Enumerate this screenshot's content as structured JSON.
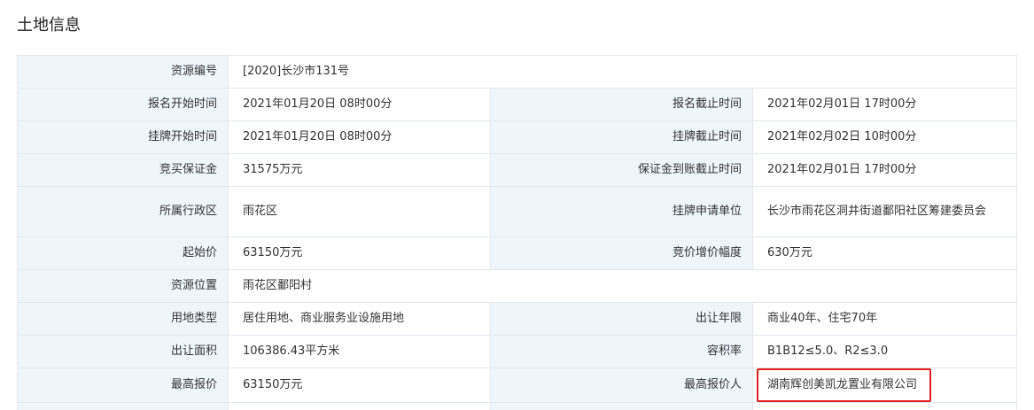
{
  "page": {
    "title": "土地信息"
  },
  "rows": [
    {
      "l1": "资源编号",
      "v1": "[2020]长沙市131号"
    },
    {
      "l1": "报名开始时间",
      "v1": "2021年01月20日 08时00分",
      "l2": "报名截止时间",
      "v2": "2021年02月01日 17时00分"
    },
    {
      "l1": "挂牌开始时间",
      "v1": "2021年01月20日 08时00分",
      "l2": "挂牌截止时间",
      "v2": "2021年02月02日 10时00分"
    },
    {
      "l1": "竞买保证金",
      "v1": "31575万元",
      "l2": "保证金到账截止时间",
      "v2": "2021年02月01日 17时00分"
    },
    {
      "l1": "所属行政区",
      "v1": "雨花区",
      "l2": "挂牌申请单位",
      "v2": "长沙市雨花区洞井街道鄱阳社区筹建委员会"
    },
    {
      "l1": "起始价",
      "v1": "63150万元",
      "l2": "竞价增价幅度",
      "v2": "630万元"
    },
    {
      "l1": "资源位置",
      "v1": "雨花区鄱阳村"
    },
    {
      "l1": "用地类型",
      "v1": "居住用地、商业服务业设施用地",
      "l2": "出让年限",
      "v2": "商业40年、住宅70年"
    },
    {
      "l1": "出让面积",
      "v1": "106386.43平方米",
      "l2": "容积率",
      "v2": "B1B12≤5.0、R2≤3.0"
    },
    {
      "l1": "最高报价",
      "v1": "63150万元",
      "l2": "最高报价人",
      "v2": "湖南辉创美凯龙置业有限公司"
    }
  ]
}
